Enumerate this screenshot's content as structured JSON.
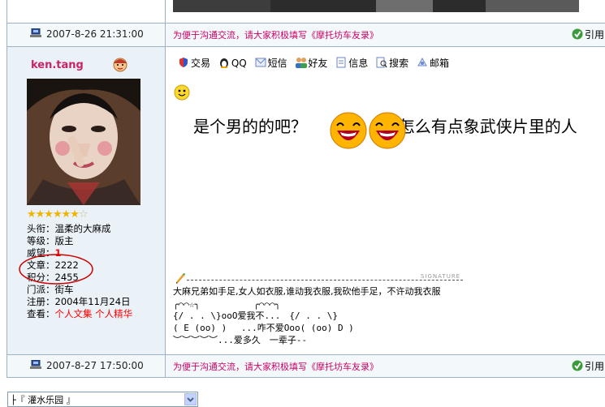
{
  "colors": {
    "border": "#9db3c5",
    "notice": "#cc0066",
    "username": "#cc2266",
    "highlight_circle": "#cc0000"
  },
  "posts": [
    {
      "time": "2007-8-26 21:31:00",
      "notice": "为便于沟通交流，请大家积极填写《摩托坊车友录》",
      "quote_label": "引用"
    },
    {
      "time": "2007-8-27 17:50:00",
      "notice": "为便于沟通交流，请大家积极填写《摩托坊车友录》",
      "quote_label": "引用"
    }
  ],
  "user": {
    "name": "ken.tang",
    "stars_filled": 6,
    "stars_total": 7,
    "title_label": "头衔：",
    "title": "温柔的大麻成",
    "level_label": "等级：",
    "level": "版主",
    "prestige_label": "威望：",
    "prestige": "1",
    "posts_label": "文章：",
    "posts": "2222",
    "points_label": "积分：",
    "points": "2455",
    "faction_label": "门派：",
    "faction": "街车",
    "registered_label": "注册：",
    "registered": "2004年11月24日",
    "view_label": "查看：",
    "view_collection": "个人文集",
    "view_best": "个人精华"
  },
  "actions": [
    "交易",
    "QQ",
    "短信",
    "好友",
    "信息",
    "搜索",
    "邮箱"
  ],
  "content": {
    "text_before": "是个男的的吧？",
    "text_after": "怎么有点象武侠片里的人"
  },
  "signature": {
    "label": "SIGNATURE",
    "line1": "大麻兄弟如手足,女人如衣服,谁动我衣服,我砍他手足，不许动我衣服",
    "line2": "╭⌒⌒☆╮　　　　　　╭⌒⌒⌒╮",
    "line3": "{/ .  . \\}ooO爱我不...　{/ .  . \\}",
    "line4": "( E (oo) )　 ...咋不爱Ooo( (oo) D )",
    "line5": "︶︶︶︶︶...爱多久　一辈子--"
  },
  "forum_select": {
    "value": "├『 灌水乐园 』"
  }
}
